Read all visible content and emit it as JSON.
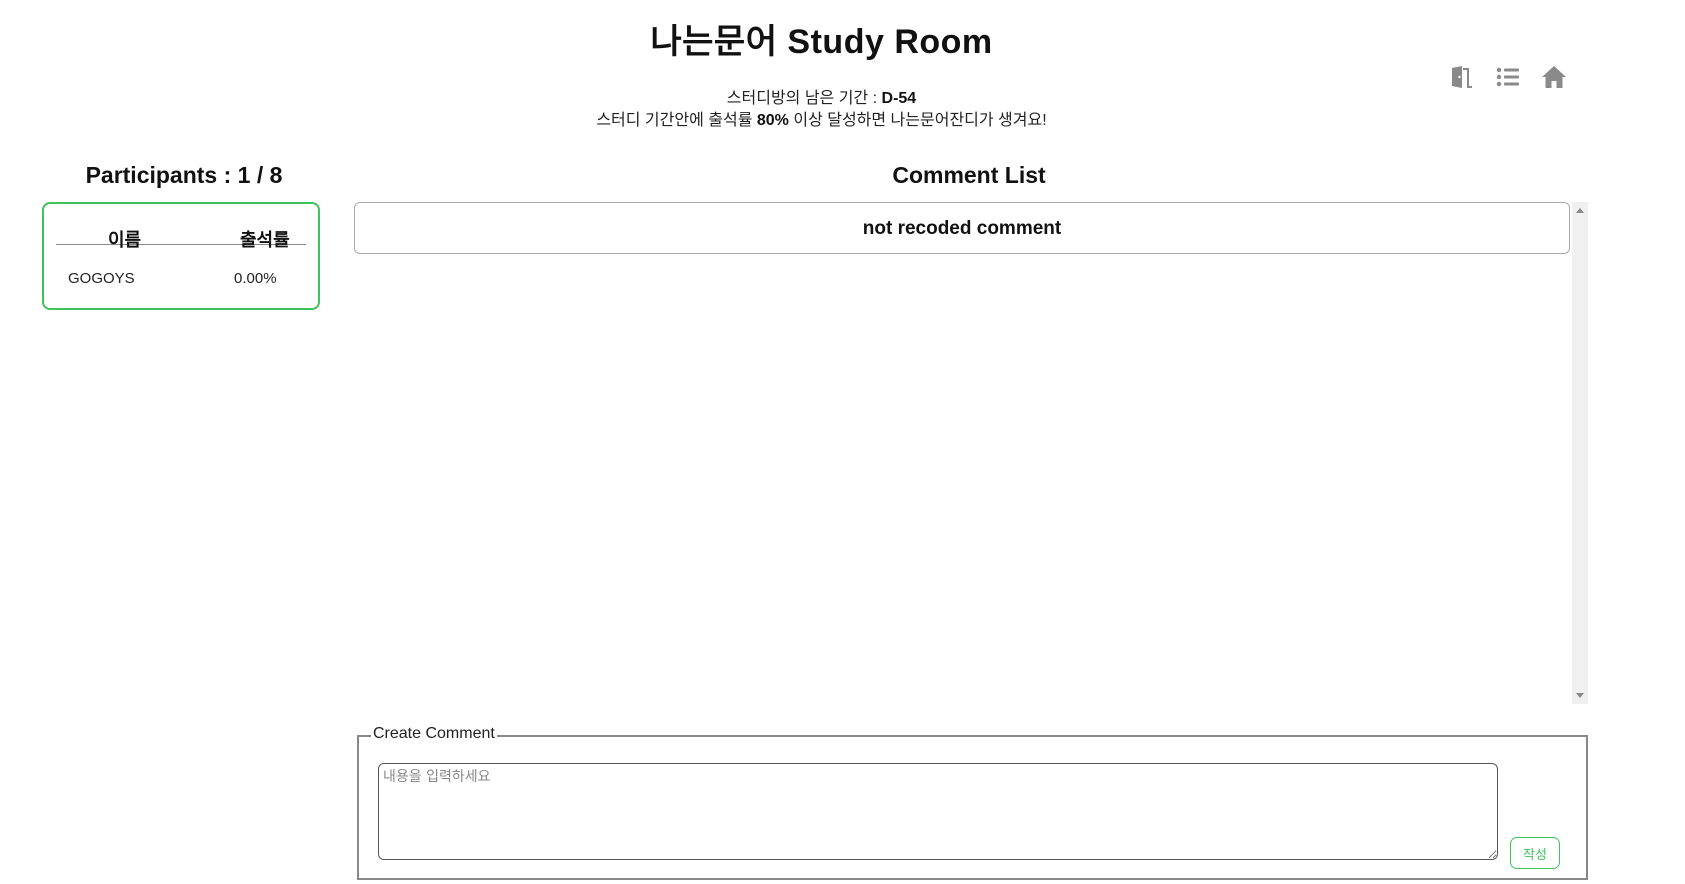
{
  "header": {
    "title": "나는문어 Study Room",
    "remaining_label": "스터디방의 남은 기간 : ",
    "remaining_value": "D-54",
    "goal_prefix": "스터디 기간안에 출석률 ",
    "goal_percent": "80%",
    "goal_suffix": " 이상 달성하면 나는문어잔디가 생겨요!"
  },
  "nav_icons": [
    {
      "icon": "door-exit-icon"
    },
    {
      "icon": "list-icon"
    },
    {
      "icon": "home-icon"
    }
  ],
  "participants": {
    "title": "Participants : 1 / 8",
    "columns": [
      "이름",
      "출석률"
    ],
    "rows": [
      {
        "name": "GOGOYS",
        "rate": "0.00%"
      }
    ]
  },
  "comments": {
    "title": "Comment List",
    "items": [
      "not recoded comment"
    ]
  },
  "create_comment": {
    "legend": "Create Comment",
    "placeholder": "내용을 입력하세요",
    "value": "",
    "submit_label": "작성"
  },
  "colors": {
    "accent_green": "#3cc45a",
    "icon_gray": "#8a8a8a"
  }
}
